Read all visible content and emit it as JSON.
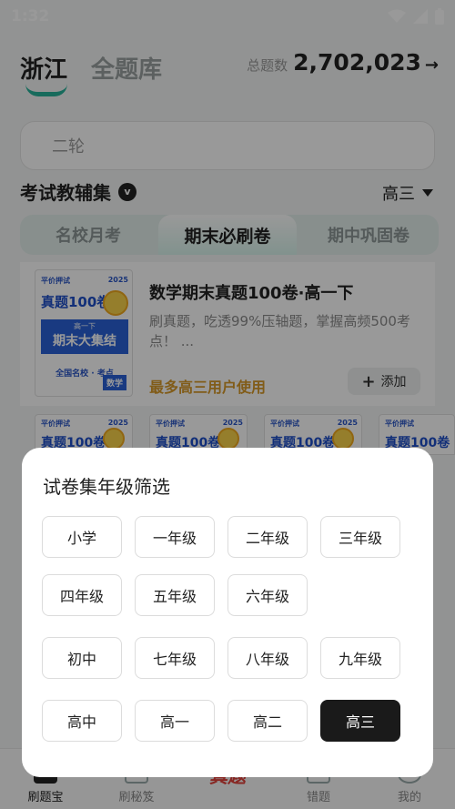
{
  "status_bar": {
    "time": "1:32"
  },
  "header": {
    "tab_region": "浙江",
    "tab_all": "全题库",
    "total_label": "总题数",
    "total_value": "2,702,023",
    "total_arrow": "→"
  },
  "search": {
    "placeholder": "二轮"
  },
  "section": {
    "title": "考试教辅集",
    "badge": "v",
    "grade_value": "高三"
  },
  "subtabs": [
    {
      "label": "名校月考"
    },
    {
      "label": "期末必刷卷"
    },
    {
      "label": "期中巩固卷"
    }
  ],
  "card": {
    "cover_brand": "平价押试",
    "cover_year": "2025",
    "cover_title": "真题100卷",
    "cover_band_small": "高一下",
    "cover_band_big": "期末大集结",
    "cover_sub": "全国名校 · 考点",
    "cover_subject": "数学",
    "title": "数学期末真题100卷·高一下",
    "desc": "刷真题，吃透99%压轴题，掌握高频500考点！ ...",
    "users": "最多高三用户使用",
    "add_label": "添加",
    "add_plus": "+"
  },
  "thumbs": [
    {
      "brand": "平价押试",
      "year": "2025",
      "title": "真题100卷"
    },
    {
      "brand": "平价押试",
      "year": "2025",
      "title": "真题100卷"
    },
    {
      "brand": "平价押试",
      "year": "2025",
      "title": "真题100卷"
    },
    {
      "brand": "平价押试",
      "year": "",
      "title": "真题100卷"
    }
  ],
  "bottom_nav": [
    {
      "label": "刷题宝"
    },
    {
      "label": "刷秘笈"
    },
    {
      "label": "错题"
    },
    {
      "label": "我的"
    }
  ],
  "bottom_nav_center": "真题",
  "dialog": {
    "title": "试卷集年级筛选",
    "rows": [
      [
        "小学",
        "一年级",
        "二年级",
        "三年级"
      ],
      [
        "四年级",
        "五年级",
        "六年级"
      ],
      [
        "初中",
        "七年级",
        "八年级",
        "九年级"
      ],
      [
        "高中",
        "高一",
        "高二",
        "高三"
      ]
    ],
    "selected": "高三"
  },
  "colors": {
    "accent": "#27b29a",
    "selected_chip": "#1a1a1a",
    "users_text": "#d79a2a",
    "cover_blue": "#2a62d8"
  }
}
